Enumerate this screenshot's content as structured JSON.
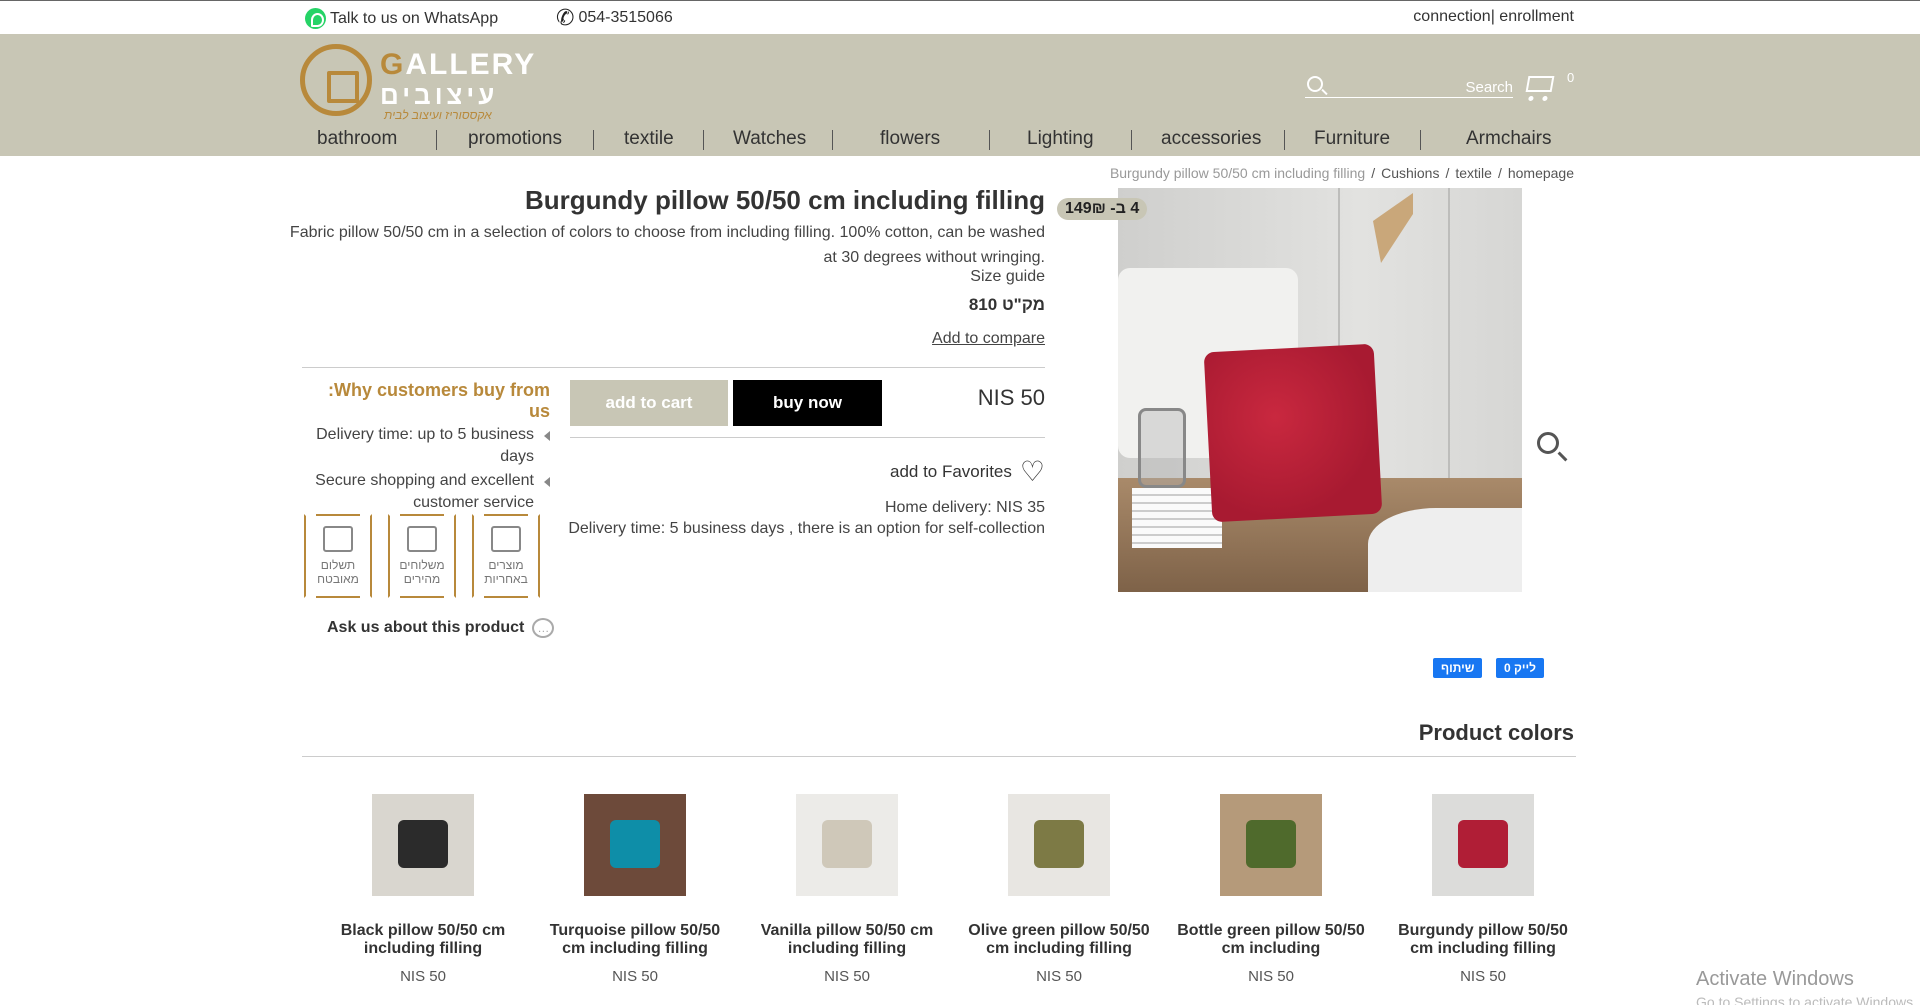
{
  "topbar": {
    "whatsapp": "Talk to us on WhatsApp",
    "phone": "054-3515066",
    "account": "connection| enrollment"
  },
  "header": {
    "logo_title_first": "G",
    "logo_title_rest": "ALLERY",
    "logo_heb": "עיצובים",
    "logo_sub": "אקססוריז ועיצוב לבית",
    "search_label": "Search",
    "cart_count": "0"
  },
  "nav": [
    "bathroom",
    "promotions",
    "textile",
    "Watches",
    "flowers",
    "Lighting",
    "accessories",
    "Furniture",
    "Armchairs"
  ],
  "breadcrumb": {
    "current": "Burgundy pillow 50/50 cm including filling",
    "sep": "/",
    "cushions": "Cushions",
    "textile": "textile",
    "home": "homepage"
  },
  "product": {
    "title": "Burgundy pillow 50/50 cm including filling",
    "description": "Fabric pillow 50/50 cm in a selection of colors to choose from including filling. 100% cotton, can be washed at 30 degrees without wringing.",
    "size_guide": "Size guide",
    "sku": "מק\"ט 810",
    "compare": "Add to compare",
    "price": "NIS 50",
    "add_to_cart": "add to cart",
    "buy_now": "buy now",
    "favorites": "add to Favorites",
    "home_delivery": "Home delivery: NIS 35",
    "delivery_time": "Delivery time: 5 business days , there is an option for self-collection",
    "sale_badge": "4 ב- 149₪"
  },
  "why": {
    "title": ":Why customers buy from us",
    "items": [
      "Delivery time: up to 5 business days",
      "Secure shopping and excellent customer service"
    ],
    "badges": [
      "תשלום מאובטח",
      "משלוחים מהירים",
      "מוצרים באחריות"
    ],
    "ask": "Ask us about this product"
  },
  "social": {
    "share": "שיתוף",
    "like": "לייק 0"
  },
  "colors_section": {
    "title": "Product colors",
    "cards": [
      {
        "name": "Black pillow 50/50 cm including filling",
        "price": "NIS 50",
        "color": "#2b2b2b",
        "bg": "#d9d6cf"
      },
      {
        "name": "Turquoise pillow 50/50 cm including filling",
        "price": "NIS 50",
        "color": "#0e8ea8",
        "bg": "#6d4a3a"
      },
      {
        "name": "Vanilla pillow 50/50 cm including filling",
        "price": "NIS 50",
        "color": "#cfc8b9",
        "bg": "#ecebe8"
      },
      {
        "name": "Olive green pillow 50/50 cm including filling",
        "price": "NIS 50",
        "color": "#7d7a45",
        "bg": "#e8e6e2"
      },
      {
        "name": "Bottle green pillow 50/50 cm including",
        "price": "NIS 50",
        "color": "#4f6a2c",
        "bg": "#b59a7a"
      },
      {
        "name": "Burgundy pillow 50/50 cm including filling",
        "price": "NIS 50",
        "color": "#b01e36",
        "bg": "#dcdcda"
      }
    ]
  },
  "watermark": {
    "line1": "Activate Windows",
    "line2": "Go to Settings to activate Windows."
  },
  "colors": {
    "accent": "#b8893b",
    "band": "#c8c6b5",
    "facebook": "#1877f2"
  }
}
